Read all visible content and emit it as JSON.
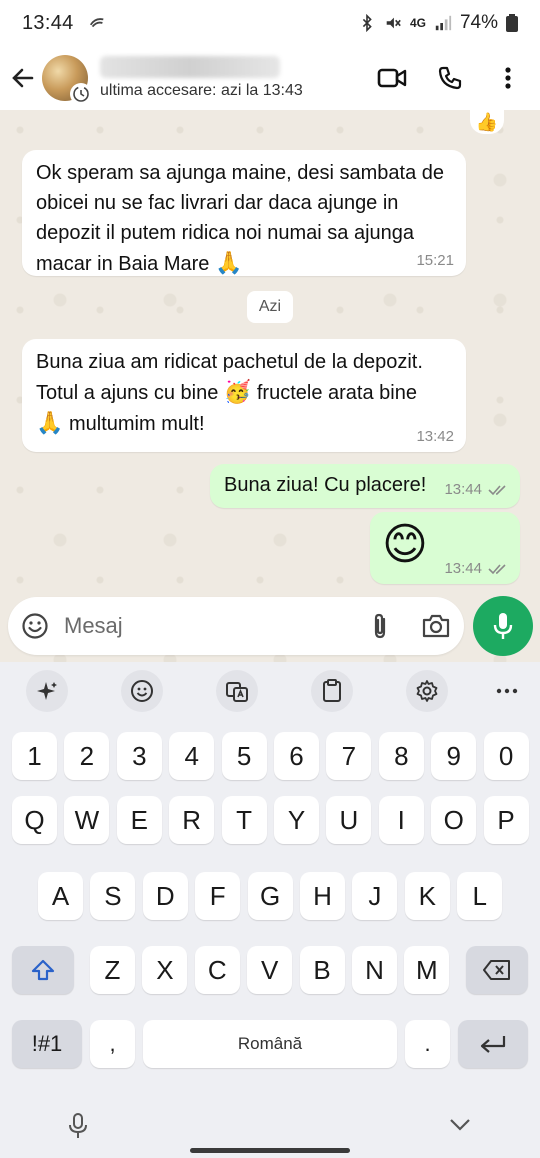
{
  "status_bar": {
    "time": "13:44",
    "battery": "74%",
    "network": "4G"
  },
  "header": {
    "last_seen": "ultima accesare: azi la 13:43"
  },
  "messages": [
    {
      "dir": "in",
      "text": "Ok speram sa ajunga maine, desi sambata de obicei nu se fac livrari dar daca ajunge in depozit il putem ridica noi numai sa ajunga macar in Baia Mare",
      "emoji": "🙏",
      "time": "15:21"
    },
    {
      "dir": "in",
      "text_a": "Buna ziua am ridicat pachetul de la depozit. Totul a ajuns cu bine",
      "emoji_a": "🥳",
      "text_b": "fructele arata bine",
      "emoji_b": "🙏",
      "text_c": "multumim mult!",
      "time": "13:42"
    },
    {
      "dir": "out",
      "text": "Buna ziua! Cu placere!",
      "time": "13:44"
    },
    {
      "dir": "out",
      "emoji": "😊",
      "time": "13:44"
    }
  ],
  "date_divider": "Azi",
  "reaction": "👍",
  "composer": {
    "placeholder": "Mesaj"
  },
  "keyboard": {
    "row_numbers": [
      "1",
      "2",
      "3",
      "4",
      "5",
      "6",
      "7",
      "8",
      "9",
      "0"
    ],
    "row_q": [
      "Q",
      "W",
      "E",
      "R",
      "T",
      "Y",
      "U",
      "I",
      "O",
      "P"
    ],
    "row_a": [
      "A",
      "S",
      "D",
      "F",
      "G",
      "H",
      "J",
      "K",
      "L"
    ],
    "row_z": [
      "Z",
      "X",
      "C",
      "V",
      "B",
      "N",
      "M"
    ],
    "symbols_label": "!#1",
    "comma": ",",
    "space_label": "Română",
    "period": "."
  },
  "colors": {
    "accent_green": "#1daa61",
    "outgoing_bubble": "#d9fdd3",
    "chat_bg": "#efeae2"
  },
  "icons": [
    "back-arrow-icon",
    "video-call-icon",
    "voice-call-icon",
    "more-vert-icon",
    "emoji-icon",
    "attach-icon",
    "camera-icon",
    "mic-icon",
    "ai-sparkle-icon",
    "sticker-icon",
    "translate-icon",
    "clipboard-icon",
    "settings-icon",
    "more-horiz-icon",
    "shift-icon",
    "backspace-icon",
    "enter-icon",
    "keyboard-mic-icon",
    "hide-keyboard-icon",
    "double-check-icon",
    "disappearing-timer-icon"
  ]
}
